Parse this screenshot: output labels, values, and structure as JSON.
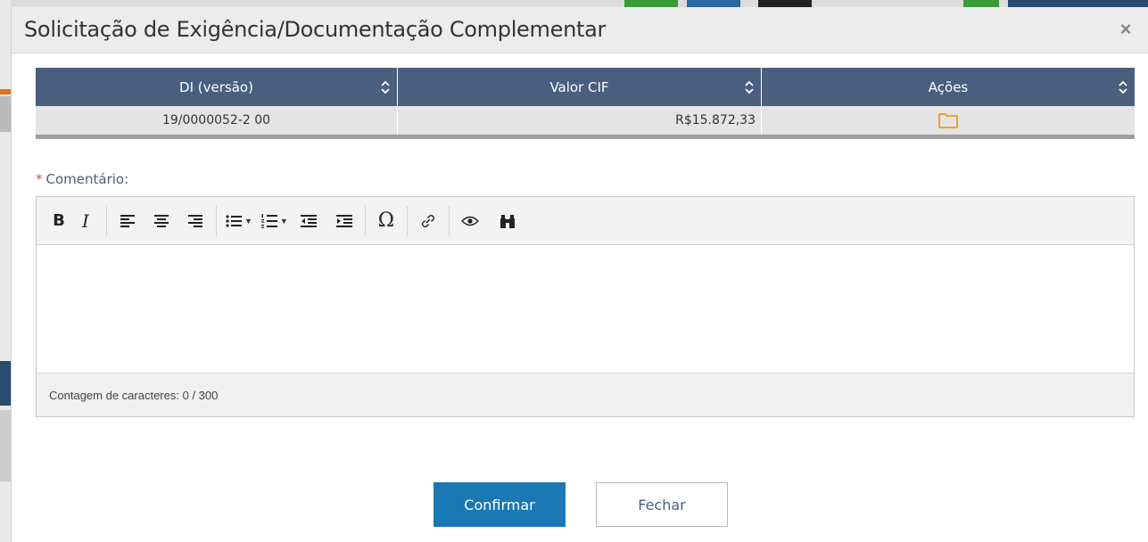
{
  "modal": {
    "title": "Solicitação de Exigência/Documentação Complementar",
    "close_glyph": "×"
  },
  "table": {
    "columns": [
      "DI (versão)",
      "Valor CIF",
      "Ações"
    ],
    "rows": [
      {
        "di_versao": "19/0000052-2 00",
        "valor_cif": "R$15.872,33",
        "acao_icon": "folder-icon"
      }
    ]
  },
  "comment": {
    "required_mark": "*",
    "label": "Comentário:"
  },
  "editor": {
    "toolbar": [
      "bold",
      "italic",
      "align-left",
      "align-center",
      "align-right",
      "bulleted-list",
      "numbered-list",
      "outdent",
      "indent",
      "special-character",
      "link",
      "preview",
      "find"
    ],
    "bold_glyph": "B",
    "italic_glyph": "I",
    "omega_glyph": "Ω",
    "content": "",
    "char_count": "Contagem de caracteres: 0 / 300"
  },
  "actions": {
    "confirm_label": "Confirmar",
    "close_label": "Fechar"
  },
  "colors": {
    "header_bg": "#4a5f7f",
    "primary": "#1a78b4",
    "folder": "#f0a030",
    "required": "#d9534f"
  }
}
